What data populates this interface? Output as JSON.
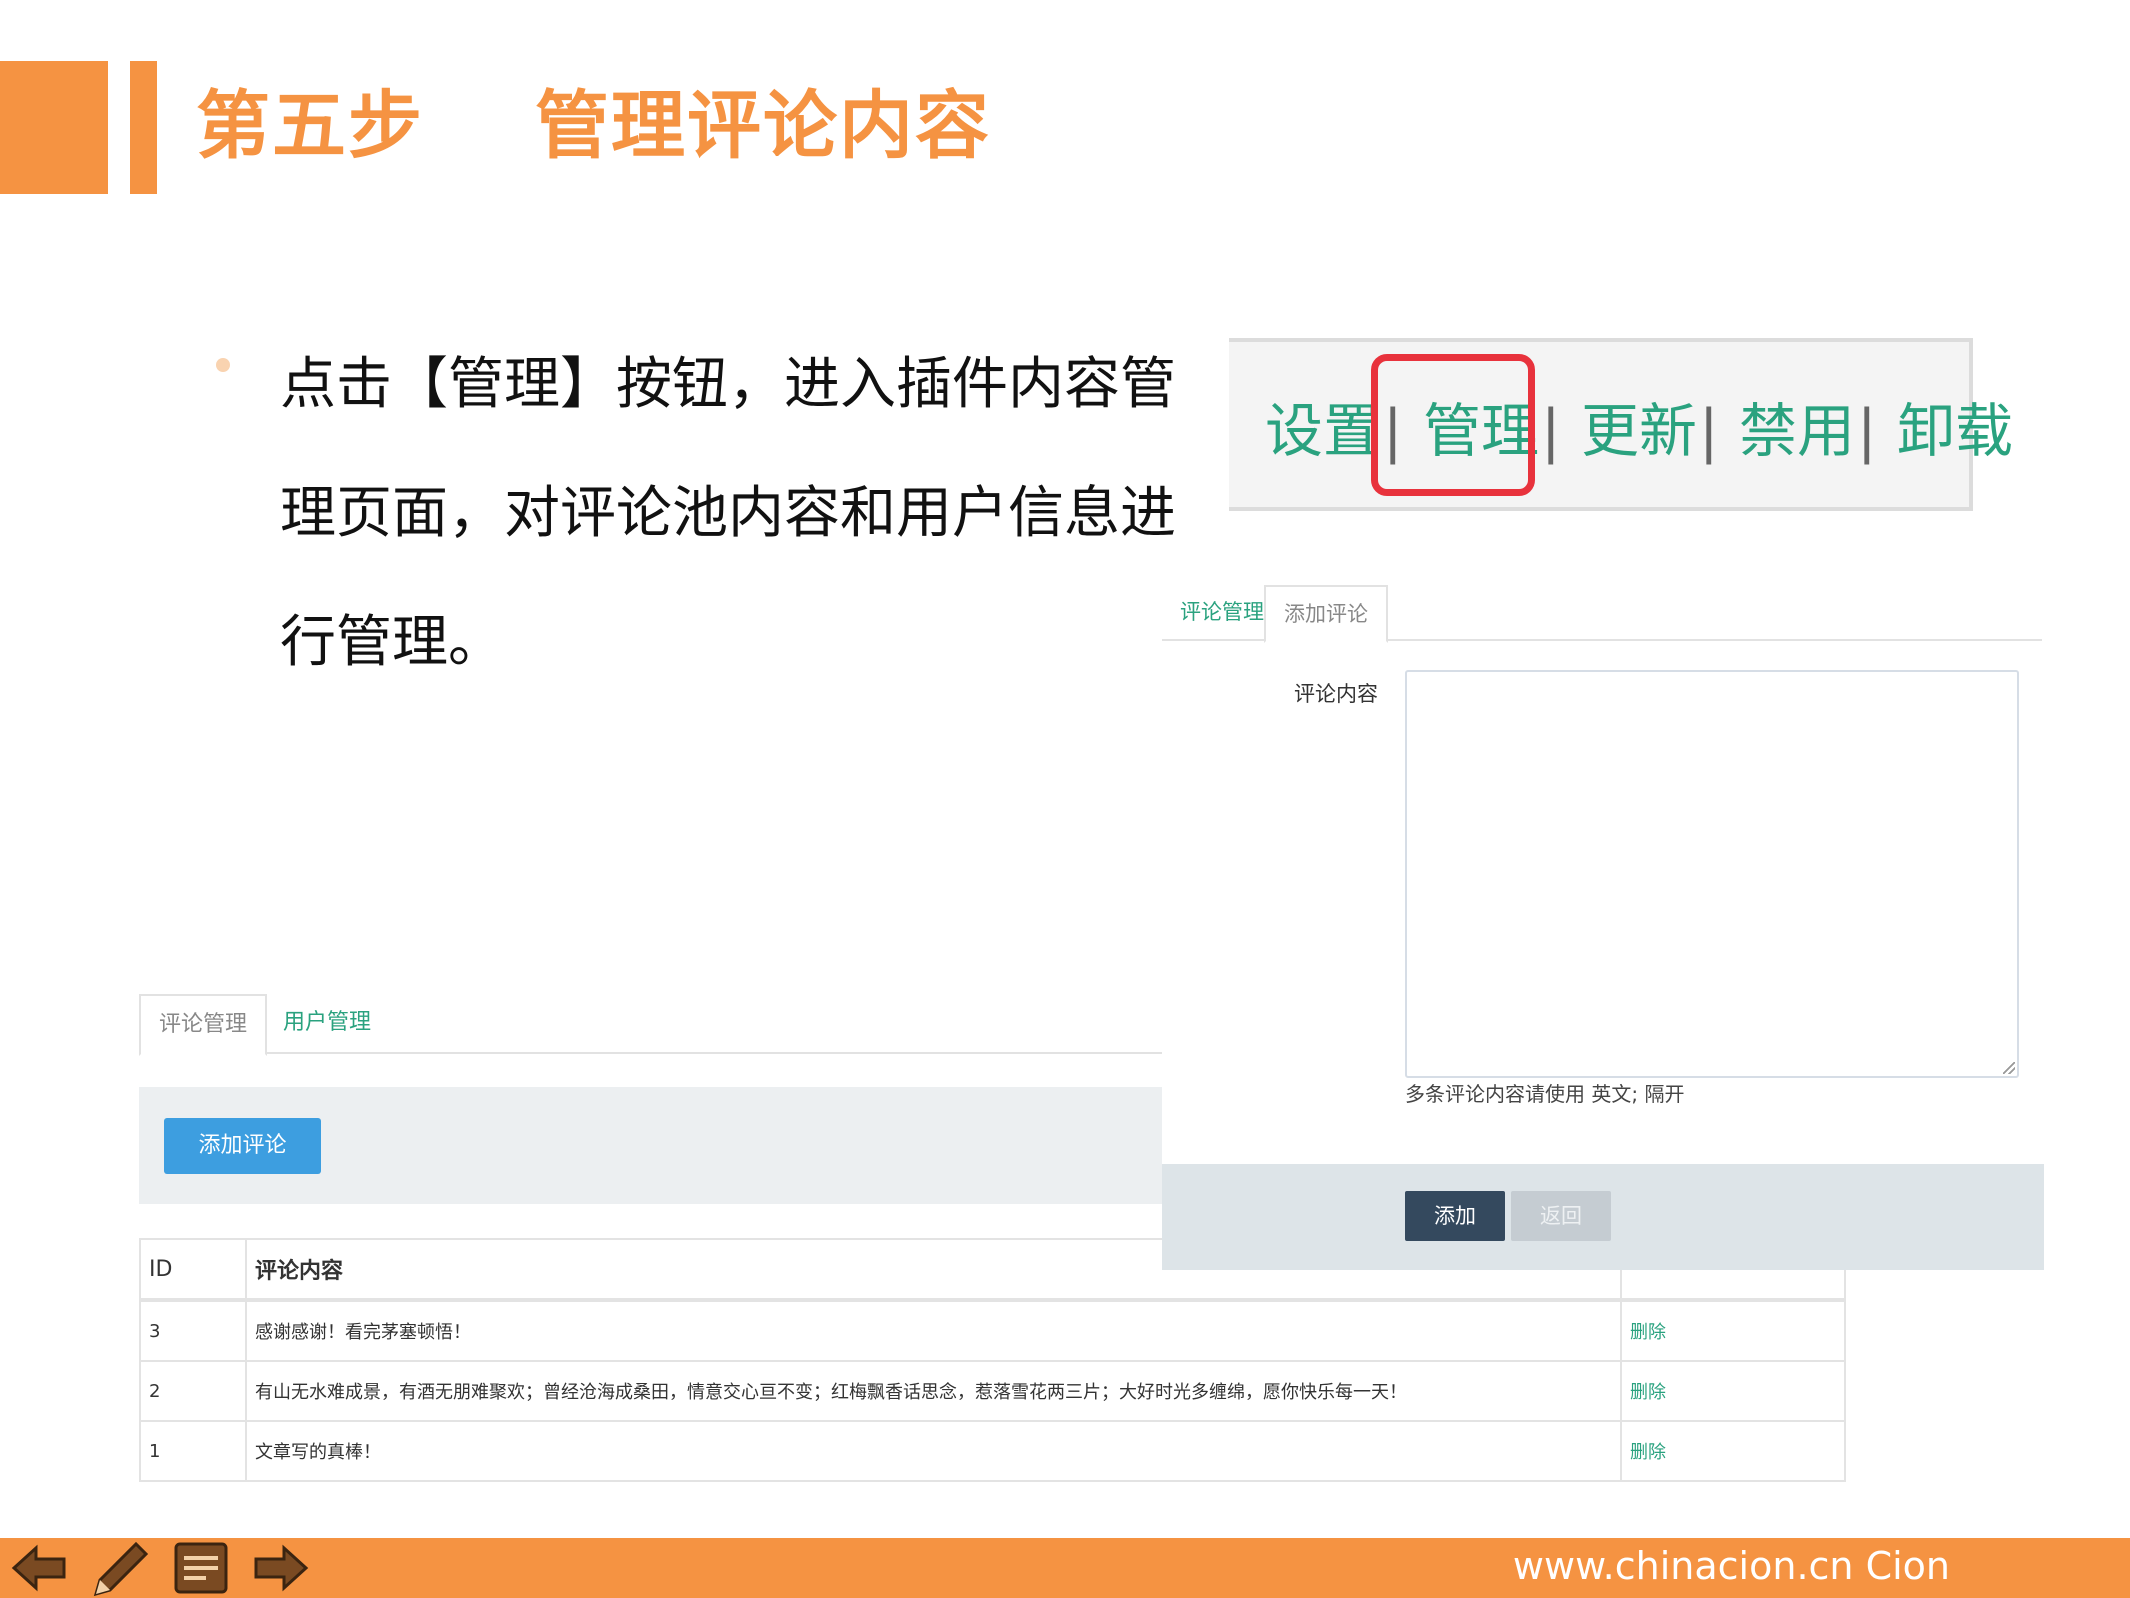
{
  "header": {
    "title": "第五步    管理评论内容"
  },
  "bullet": {
    "text": "点击【管理】按钮，进入插件内容管理页面，对评论池内容和用户信息进行管理。"
  },
  "action_bar": {
    "settings": "设置",
    "manage": "管理",
    "update": "更新",
    "disable": "禁用",
    "uninstall": "卸载",
    "separator": "|"
  },
  "add_panel": {
    "tabs": [
      "评论管理",
      "添加评论"
    ],
    "content_label": "评论内容",
    "hint": "多条评论内容请使用 英文; 隔开",
    "add_button": "添加",
    "back_button": "返回"
  },
  "manage_panel": {
    "tabs": [
      "评论管理",
      "用户管理"
    ],
    "add_comment_button": "添加评论",
    "table": {
      "headers": [
        "ID",
        "评论内容"
      ],
      "rows": [
        {
          "id": "3",
          "content": "感谢感谢！看完茅塞顿悟！",
          "action": "删除"
        },
        {
          "id": "2",
          "content": "有山无水难成景，有酒无朋难聚欢；曾经沧海成桑田，情意交心亘不变；红梅飘香话思念，惹落雪花两三片；大好时光多缠绵，愿你快乐每一天！",
          "action": "删除"
        },
        {
          "id": "1",
          "content": "文章写的真棒！",
          "action": "删除"
        }
      ]
    }
  },
  "footer": {
    "url": "www.chinacion.cn  Cion"
  },
  "icons": [
    "arrow-left-icon",
    "pencil-icon",
    "note-icon",
    "arrow-right-icon"
  ],
  "colors": {
    "accent": "#f59342",
    "link_green": "#2aa27f",
    "highlight_red": "#e8323c",
    "primary_blue": "#3d9ee0",
    "dark_button": "#34495e"
  }
}
